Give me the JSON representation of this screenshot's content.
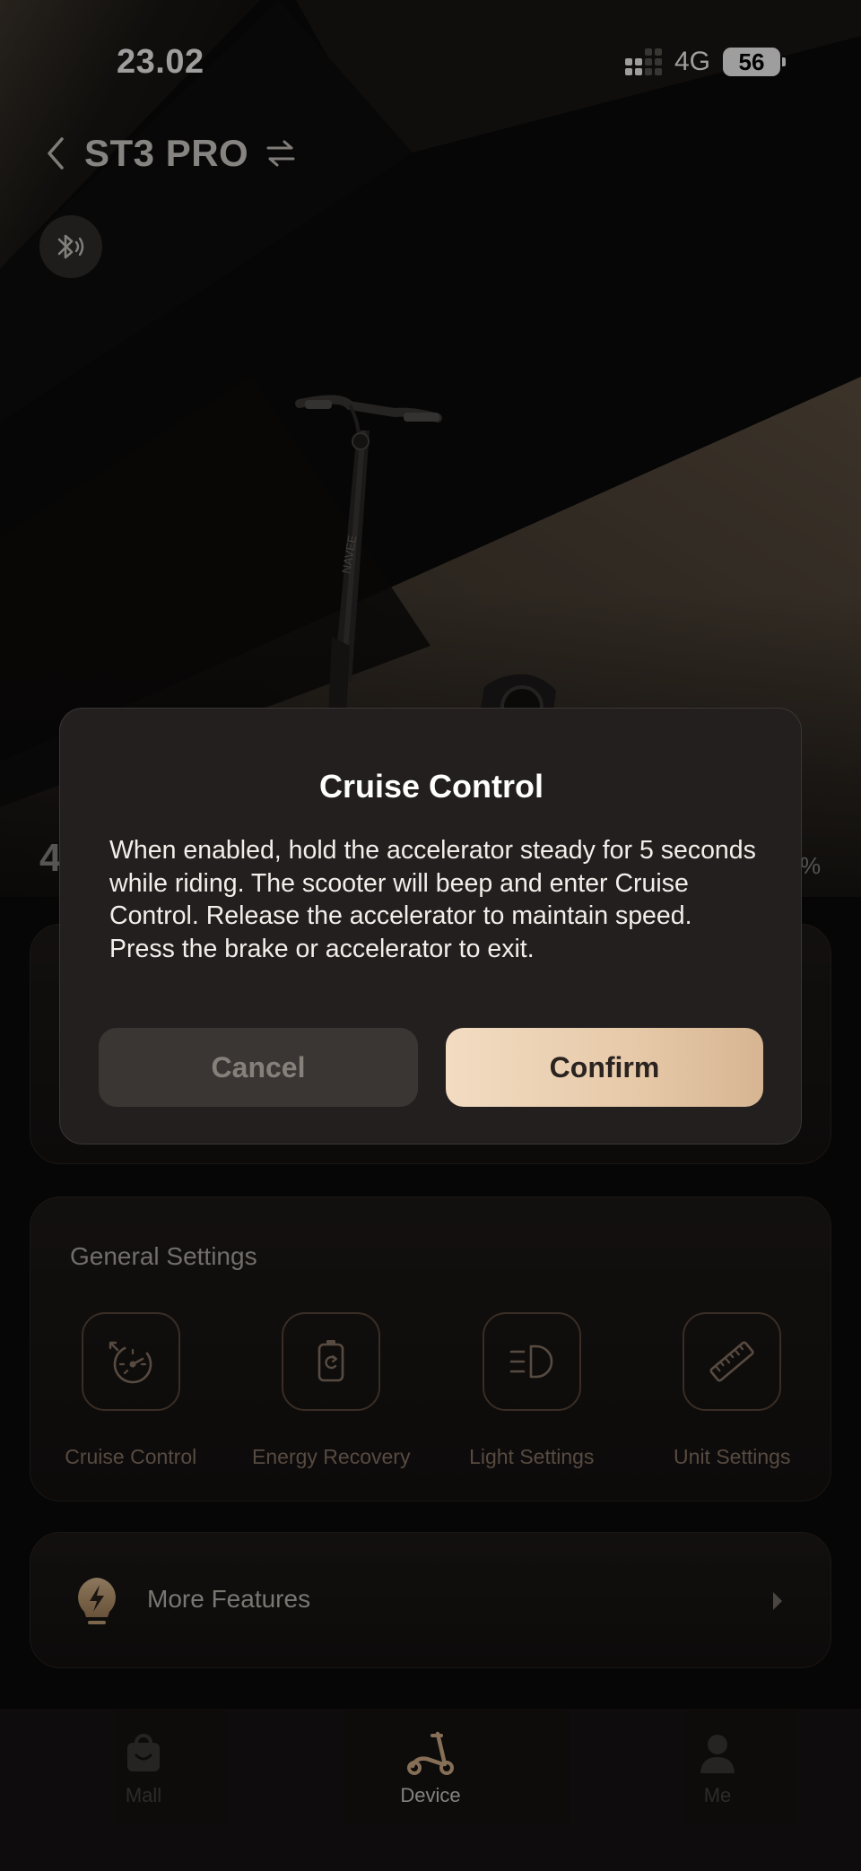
{
  "status_bar": {
    "time": "23.02",
    "network": "4G",
    "battery": "56"
  },
  "header": {
    "device_name": "ST3 PRO"
  },
  "peek": {
    "left_text": "4",
    "right_text": "%"
  },
  "general_settings": {
    "title": "General Settings",
    "items": [
      {
        "label": "Cruise Control",
        "icon": "speedometer-icon"
      },
      {
        "label": "Energy Recovery",
        "icon": "battery-recycle-icon"
      },
      {
        "label": "Light Settings",
        "icon": "headlight-icon"
      },
      {
        "label": "Unit Settings",
        "icon": "ruler-icon"
      }
    ]
  },
  "more_features": {
    "label": "More Features",
    "icon": "lightning-bulb-icon"
  },
  "tab_bar": {
    "tabs": [
      {
        "label": "Mall",
        "icon": "shopping-bag-icon",
        "active": false
      },
      {
        "label": "Device",
        "icon": "scooter-icon",
        "active": true
      },
      {
        "label": "Me",
        "icon": "person-icon",
        "active": false
      }
    ]
  },
  "dialog": {
    "title": "Cruise Control",
    "body": "When enabled, hold the accelerator steady for 5 seconds while riding. The scooter will beep and enter Cruise Control. Release the accelerator to maintain speed. Press the brake or accelerator to exit.",
    "cancel_label": "Cancel",
    "confirm_label": "Confirm"
  },
  "colors": {
    "accent": "#e6c9a8",
    "icon_stroke": "#8d7868",
    "background": "#0b0a0a"
  }
}
